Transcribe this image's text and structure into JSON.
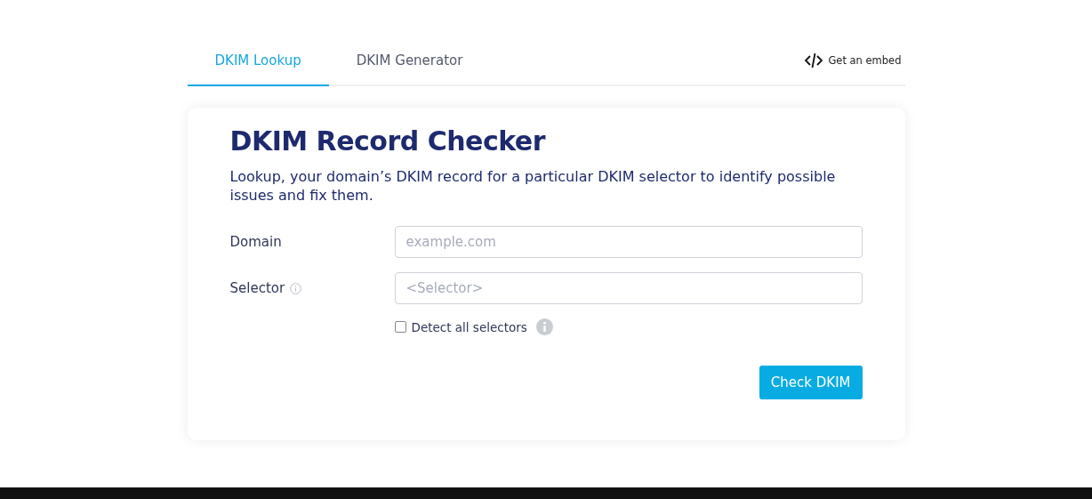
{
  "tabs": [
    {
      "label": "DKIM Lookup",
      "selected": true
    },
    {
      "label": "DKIM Generator",
      "selected": false
    }
  ],
  "embed_link": "Get an embed",
  "card": {
    "title": "DKIM Record Checker",
    "description": "Lookup, your domain’s DKIM record for a particular DKIM selector to identify possible issues and fix them.",
    "fields": [
      {
        "label": "Domain",
        "placeholder": "example.com",
        "info": false
      },
      {
        "label": "Selector",
        "placeholder": "<Selector>",
        "info": true
      }
    ],
    "detect_all": {
      "label": "Detect all selectors",
      "checked": false
    },
    "submit": "Check DKIM"
  }
}
